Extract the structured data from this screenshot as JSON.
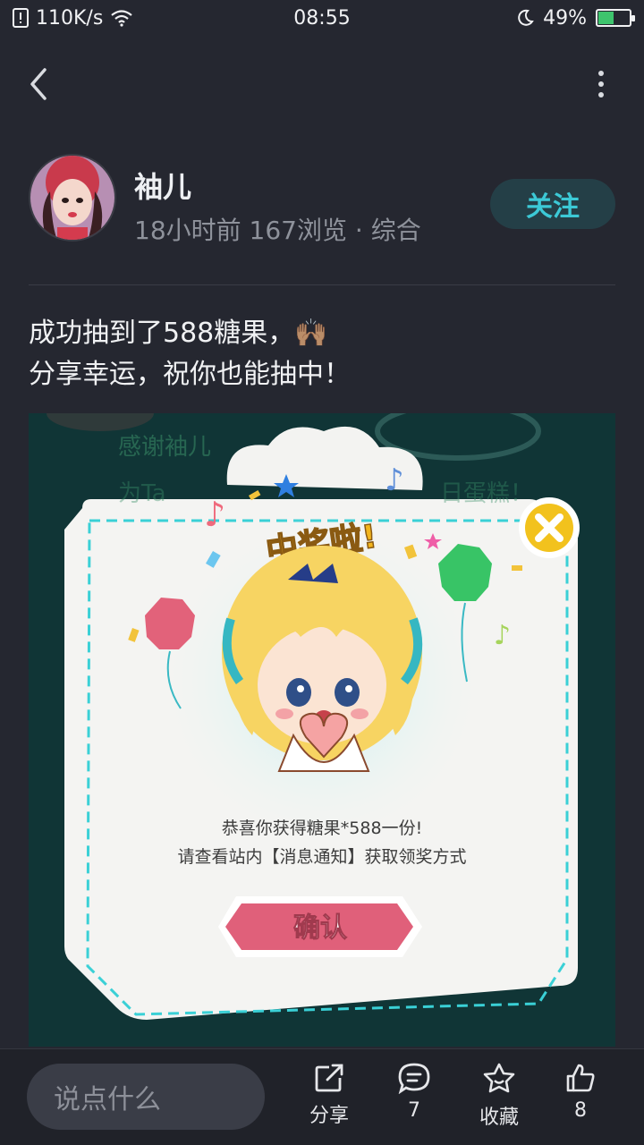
{
  "status_bar": {
    "network_speed": "110K/s",
    "time": "08:55",
    "battery": "49%",
    "battery_level": 0.49
  },
  "author": {
    "name": "袖儿",
    "time_ago": "18小时前",
    "views": "167浏览",
    "separator": "·",
    "category": "综合",
    "follow_label": "关注"
  },
  "post": {
    "line1": "成功抽到了588糖果，🙌🏽",
    "line2": "分享幸运，祝你也能抽中！"
  },
  "image": {
    "bg_text1": "感谢袖儿",
    "bg_text2": "为Ta",
    "bg_text3": "日蛋糕！",
    "title": "中奖啦!",
    "message1": "恭喜你获得糖果*588一份!",
    "message2": "请查看站内【消息通知】获取领奖方式",
    "confirm": "确认"
  },
  "bottom_bar": {
    "comment_placeholder": "说点什么",
    "share_label": "分享",
    "comment_count": "7",
    "favorite_label": "收藏",
    "like_count": "8"
  },
  "colors": {
    "background": "#252730",
    "follow_text": "#3cc9d6",
    "confirm_button": "#e0607a",
    "dialog_dash": "#3ad0d6"
  }
}
